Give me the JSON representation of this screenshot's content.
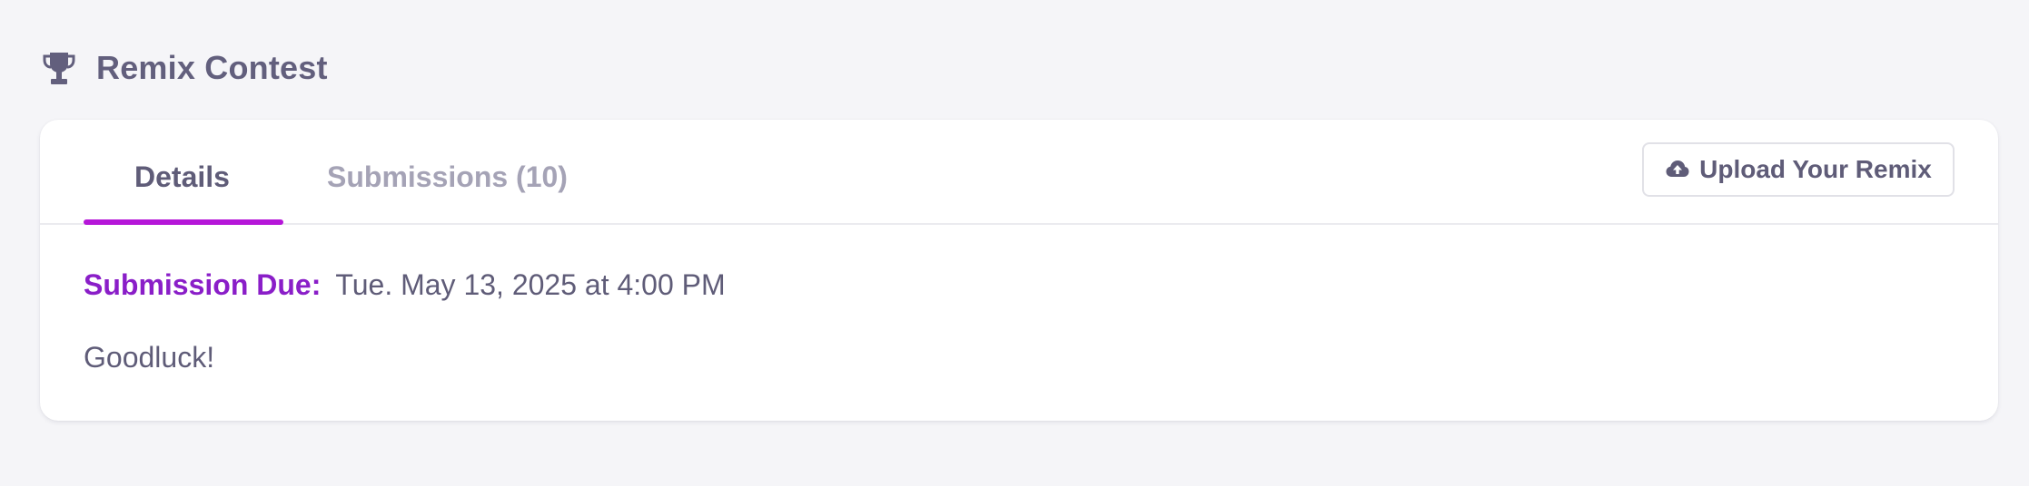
{
  "section": {
    "icon": "trophy-icon",
    "title": "Remix Contest"
  },
  "tabs": [
    {
      "label": "Details",
      "active": true
    },
    {
      "label": "Submissions (10)",
      "active": false
    }
  ],
  "actions": {
    "upload_icon": "cloud-upload-icon",
    "upload_label": "Upload Your Remix"
  },
  "details": {
    "due_label": "Submission Due:",
    "due_value": "Tue. May 13, 2025 at 4:00 PM",
    "description": "Goodluck!"
  },
  "colors": {
    "accent": "#b516d8",
    "due_label": "#8a1ec8",
    "text": "#5f5c78",
    "muted_text": "#a5a3b6",
    "background": "#f5f5f8"
  }
}
